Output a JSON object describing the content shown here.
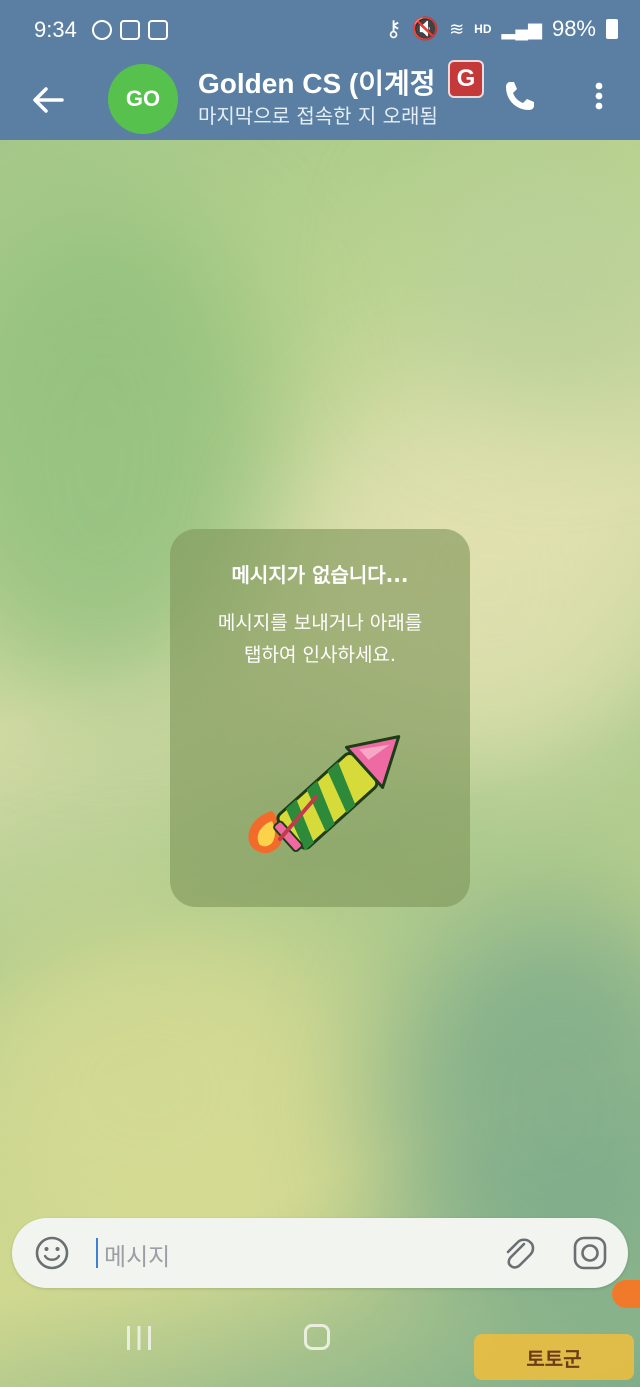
{
  "status_bar": {
    "time": "9:34",
    "battery": "98%",
    "network_label": "HD"
  },
  "header": {
    "avatar_initials": "GO",
    "title": "Golden CS (이계정",
    "badge_letter": "G",
    "subtitle": "마지막으로 접속한 지 오래됨"
  },
  "empty_state": {
    "title": "메시지가 없습니다...",
    "description_line1": "메시지를 보내거나 아래를",
    "description_line2": "탭하여 인사하세요.",
    "sticker": "rocket-firework"
  },
  "input": {
    "placeholder": "메시지"
  },
  "watermark": {
    "text": "토토군"
  },
  "colors": {
    "header_bg": "#5a7fa3",
    "avatar_bg": "#56c24d",
    "badge_bg": "#c4393a",
    "caret": "#3f7fd9"
  }
}
